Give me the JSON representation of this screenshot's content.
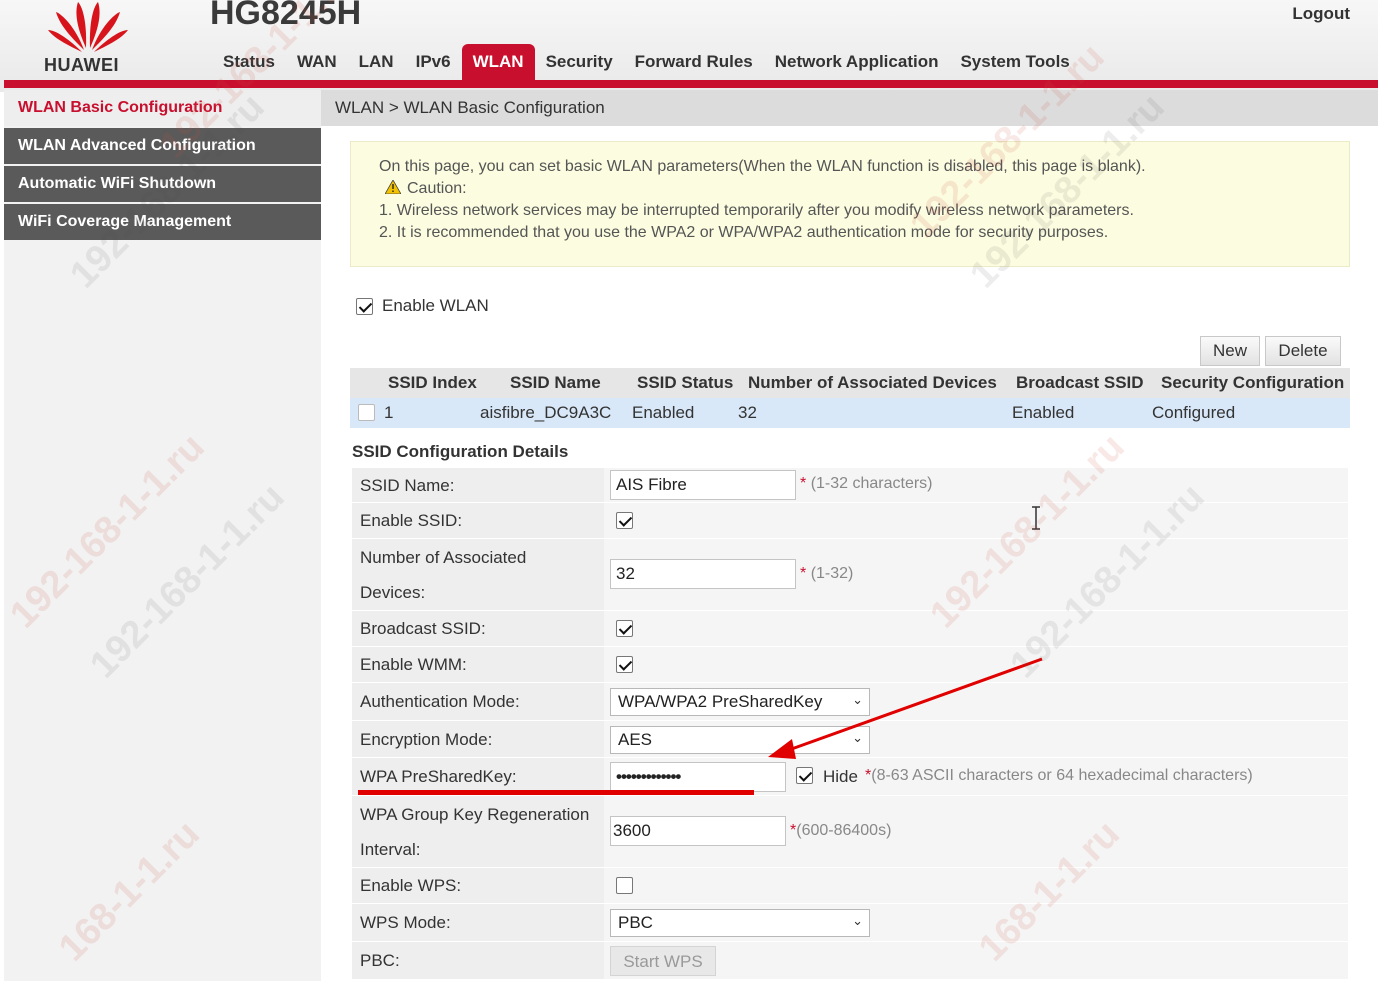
{
  "header": {
    "brand": "HUAWEI",
    "model": "HG8245H",
    "logout": "Logout",
    "nav": [
      "Status",
      "WAN",
      "LAN",
      "IPv6",
      "WLAN",
      "Security",
      "Forward Rules",
      "Network Application",
      "System Tools"
    ],
    "active_nav": "WLAN"
  },
  "sidebar": {
    "items": [
      {
        "label": "WLAN Basic Configuration",
        "active": true
      },
      {
        "label": "WLAN Advanced Configuration",
        "active": false
      },
      {
        "label": "Automatic WiFi Shutdown",
        "active": false
      },
      {
        "label": "WiFi Coverage Management",
        "active": false
      }
    ]
  },
  "breadcrumb": "WLAN > WLAN Basic Configuration",
  "info": {
    "line1": "On this page, you can set basic WLAN parameters(When the WLAN function is disabled, this page is blank).",
    "caution": "Caution:",
    "note1": "1. Wireless network services may be interrupted temporarily after you modify wireless network parameters.",
    "note2": "2. It is recommended that you use the WPA2 or WPA/WPA2 authentication mode for security purposes."
  },
  "enable_wlan": {
    "label": "Enable WLAN",
    "checked": true
  },
  "buttons": {
    "new": "New",
    "delete": "Delete"
  },
  "ssid_table": {
    "headers": [
      "SSID Index",
      "SSID Name",
      "SSID Status",
      "Number of Associated Devices",
      "Broadcast SSID",
      "Security Configuration"
    ],
    "rows": [
      {
        "index": "1",
        "name": "aisfibre_DC9A3C",
        "status": "Enabled",
        "devices": "32",
        "broadcast": "Enabled",
        "security": "Configured"
      }
    ]
  },
  "details": {
    "title": "SSID Configuration Details",
    "ssid_name": {
      "label": "SSID Name:",
      "value": "AIS Fibre",
      "hint": "(1-32 characters)"
    },
    "enable_ssid": {
      "label": "Enable SSID:",
      "checked": true
    },
    "assoc_devices": {
      "label1": "Number of Associated",
      "label2": "Devices:",
      "value": "32",
      "hint": "(1-32)"
    },
    "broadcast_ssid": {
      "label": "Broadcast SSID:",
      "checked": true
    },
    "enable_wmm": {
      "label": "Enable WMM:",
      "checked": true
    },
    "auth_mode": {
      "label": "Authentication Mode:",
      "value": "WPA/WPA2 PreSharedKey"
    },
    "encryption_mode": {
      "label": "Encryption Mode:",
      "value": "AES"
    },
    "psk": {
      "label": "WPA PreSharedKey:",
      "value": "•••••••••••••",
      "hide_label": "Hide",
      "hide_checked": true,
      "hint": "(8-63 ASCII characters or 64 hexadecimal characters)"
    },
    "group_key": {
      "label1": "WPA Group Key Regeneration",
      "label2": "Interval:",
      "value": "3600",
      "hint": "(600-86400s)"
    },
    "enable_wps": {
      "label": "Enable WPS:",
      "checked": false
    },
    "wps_mode": {
      "label": "WPS Mode:",
      "value": "PBC"
    },
    "pbc": {
      "label": "PBC:",
      "button": "Start WPS"
    }
  },
  "star": "*",
  "watermark_text": "192-168-1-1.ru",
  "watermark_text2": "168-1-1.ru",
  "colors": {
    "brand_red": "#c8102e",
    "annotation_red": "#e00000",
    "info_bg": "#fcfce0",
    "row_selected": "#d8e8f8"
  }
}
